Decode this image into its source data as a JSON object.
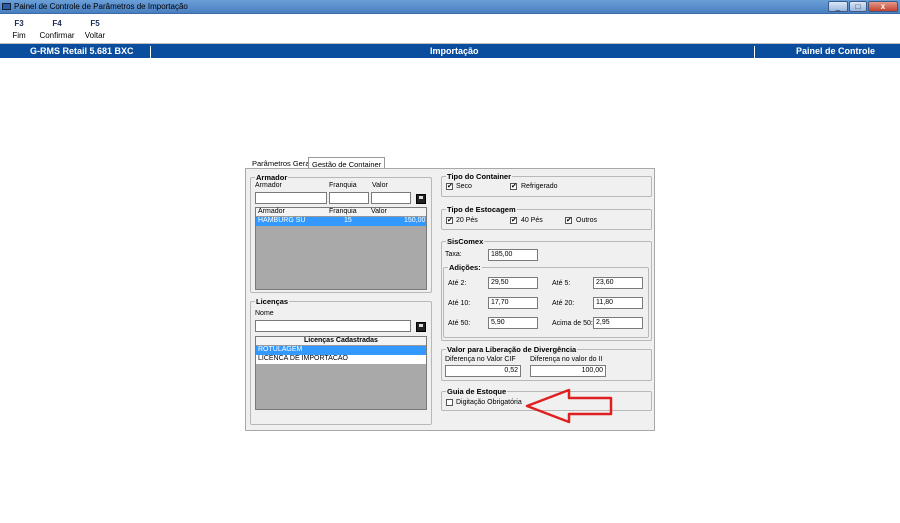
{
  "window": {
    "title": "Painel de Controle de Parâmetros de Importação"
  },
  "toolbar": [
    {
      "key": "F3",
      "label": "Fim"
    },
    {
      "key": "F4",
      "label": "Confirmar"
    },
    {
      "key": "F5",
      "label": "Voltar"
    }
  ],
  "bluebar": {
    "left": "G-RMS Retail 5.681 BXC",
    "center": "Importação",
    "right": "Painel de Controle"
  },
  "tabs": [
    {
      "label": "Parâmetros Gerais"
    },
    {
      "label": "Gestão de Container"
    }
  ],
  "armador": {
    "legend": "Armador",
    "labels": {
      "armador": "Armador",
      "franquia": "Franquia",
      "valor": "Valor"
    },
    "grid_headers": [
      "Armador",
      "Franquia",
      "Valor"
    ],
    "rows": [
      {
        "armador": "HAMBURG SU",
        "franquia": "15",
        "valor": "150,00"
      }
    ]
  },
  "licencas": {
    "legend": "Licenças",
    "nome_label": "Nome",
    "grid_header": "Licenças Cadastradas",
    "items": [
      "ROTULAGEM",
      "LICENCA DE IMPORTACAO"
    ]
  },
  "tipo_container": {
    "legend": "Tipo do Container",
    "options": [
      {
        "label": "Seco",
        "checked": true
      },
      {
        "label": "Refrigerado",
        "checked": true
      }
    ]
  },
  "tipo_estocagem": {
    "legend": "Tipo de Estocagem",
    "options": [
      {
        "label": "20 Pés",
        "checked": true
      },
      {
        "label": "40 Pés",
        "checked": true
      },
      {
        "label": "Outros",
        "checked": true
      }
    ]
  },
  "siscomex": {
    "legend": "SisComex",
    "taxa_label": "Taxa:",
    "taxa": "185,00",
    "adicoes_legend": "Adições:",
    "fields": [
      {
        "label": "Até 2:",
        "value": "29,50"
      },
      {
        "label": "Até 5:",
        "value": "23,60"
      },
      {
        "label": "Até 10:",
        "value": "17,70"
      },
      {
        "label": "Até 20:",
        "value": "11,80"
      },
      {
        "label": "Até 50:",
        "value": "5,90"
      },
      {
        "label": "Acima de 50:",
        "value": "2,95"
      }
    ]
  },
  "divergencia": {
    "legend": "Valor para Liberação de Divergência",
    "cif_label": "Diferença no Valor CIF",
    "cif_value": "0,52",
    "ii_label": "Diferença no valor do II",
    "ii_value": "100,00"
  },
  "guia": {
    "legend": "Guia de Estoque",
    "checkbox_label": "Digitação Obrigatória",
    "checked": false
  },
  "check_mark": "✔",
  "colors": {
    "accent": "#0a4d9e",
    "selection": "#3399ff",
    "arrow": "#e02020"
  }
}
